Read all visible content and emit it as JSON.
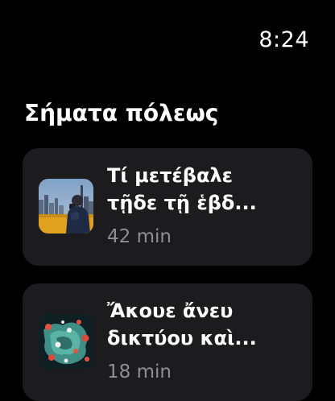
{
  "status": {
    "time": "8:24"
  },
  "section": {
    "title": "Σήματα πόλεως"
  },
  "episodes": [
    {
      "title_line1": "Τί μετέβαλε",
      "title_line2": "τῇδε τῇ ἑβδ...",
      "duration": "42 min",
      "artwork_icon": "city-skyline-person-artwork"
    },
    {
      "title_line1": "Ἄκουε ἄνευ",
      "title_line2": "δικτύου καὶ...",
      "duration": "18 min",
      "artwork_icon": "map-markers-artwork"
    }
  ],
  "colors": {
    "background": "#000000",
    "card": "#1c1c1e",
    "primary_text": "#ffffff",
    "secondary_text": "#8e8e93"
  }
}
